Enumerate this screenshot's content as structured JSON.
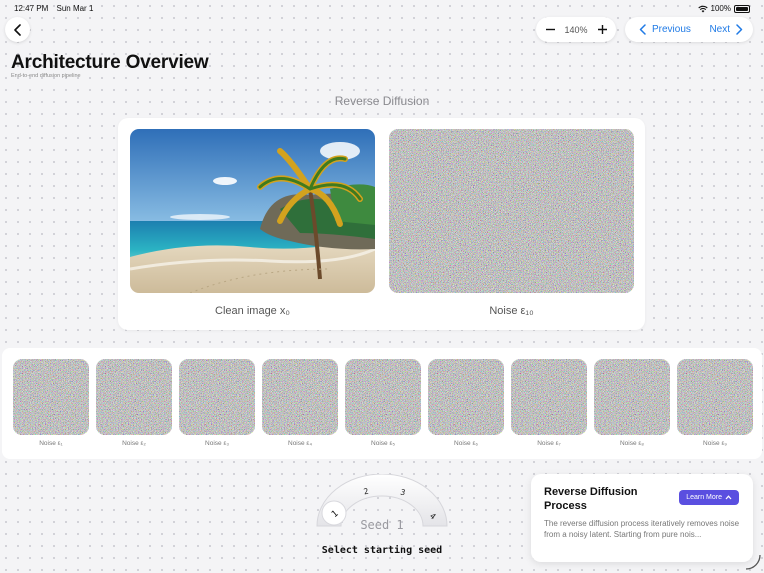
{
  "status_bar": {
    "time": "12:47 PM",
    "date": "Sun Mar 1",
    "battery": "100%"
  },
  "toolbar": {
    "zoom": "140%",
    "previous_label": "Previous",
    "next_label": "Next"
  },
  "page": {
    "title": "Architecture Overview",
    "subtitle": "End-to-end diffusion pipeline"
  },
  "section": {
    "title": "Reverse Diffusion",
    "clean_caption": "Clean image x₀",
    "noise_caption": "Noise ε₁₀"
  },
  "strip": {
    "labels": [
      "Noise ε₁",
      "Noise ε₂",
      "Noise ε₃",
      "Noise ε₄",
      "Noise ε₅",
      "Noise ε₆",
      "Noise ε₇",
      "Noise ε₈",
      "Noise ε₉"
    ]
  },
  "dial": {
    "ticks": [
      "1",
      "2",
      "3",
      "4"
    ],
    "center_label": "Seed 1",
    "caption": "Select starting seed"
  },
  "info": {
    "title": "Reverse Diffusion Process",
    "button_label": "Learn More",
    "body": "The reverse diffusion process iteratively removes noise from a noisy latent. Starting from pure nois..."
  },
  "colors": {
    "accent_blue": "#1f7ae6",
    "button_purple": "#5a4fe0"
  }
}
